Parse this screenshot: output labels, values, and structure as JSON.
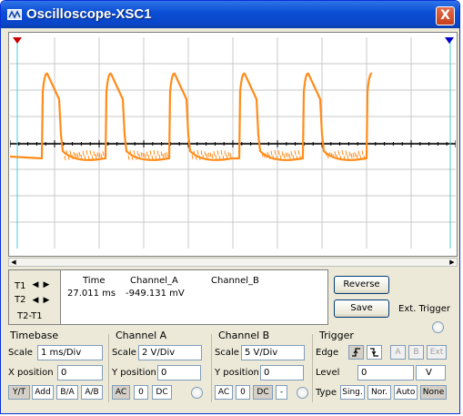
{
  "window": {
    "title": "Oscilloscope-XSC1",
    "close_glyph": "X"
  },
  "colors": {
    "title_bar": "#0a46c8",
    "trace_a": "#ff8c1a",
    "cursor_1": "#cc0000",
    "cursor_2": "#0000cc",
    "cursor_line": "#44cccc",
    "grid": "#c8c8c8",
    "axis": "#000000",
    "window_bg": "#ece9d8"
  },
  "display": {
    "cursor_markers": {
      "t1": "red-triangle",
      "t2": "blue-triangle"
    }
  },
  "readout": {
    "rows": [
      "T1",
      "T2"
    ],
    "t2t1_label": "T2-T1",
    "headers": {
      "time": "Time",
      "channel_a": "Channel_A",
      "channel_b": "Channel_B"
    },
    "values": {
      "time": "27.011 ms",
      "channel_a": "-949.131 mV",
      "channel_b": ""
    }
  },
  "buttons": {
    "reverse": "Reverse",
    "save": "Save",
    "ext_trigger": "Ext. Trigger"
  },
  "timebase": {
    "title": "Timebase",
    "scale_label": "Scale",
    "scale_value": "1 ms/Div",
    "xpos_label": "X position",
    "xpos_value": "0",
    "modes": [
      "Y/T",
      "Add",
      "B/A",
      "A/B"
    ],
    "selected_mode": "Y/T"
  },
  "channel_a": {
    "title": "Channel A",
    "scale_label": "Scale",
    "scale_value": "2  V/Div",
    "ypos_label": "Y position",
    "ypos_value": "0",
    "coupling": [
      "AC",
      "0",
      "DC"
    ],
    "selected_coupling": "AC"
  },
  "channel_b": {
    "title": "Channel B",
    "scale_label": "Scale",
    "scale_value": "5  V/Div",
    "ypos_label": "Y position",
    "ypos_value": "0",
    "coupling": [
      "AC",
      "0",
      "DC",
      "-"
    ],
    "selected_coupling": "DC"
  },
  "trigger": {
    "title": "Trigger",
    "edge_label": "Edge",
    "edge_buttons": [
      "rising-edge-icon",
      "falling-edge-icon"
    ],
    "source_buttons": [
      "A",
      "B",
      "Ext"
    ],
    "level_label": "Level",
    "level_value": "0",
    "level_unit": "V",
    "type_label": "Type",
    "types": [
      "Sing.",
      "Nor.",
      "Auto",
      "None"
    ],
    "selected_type": "None"
  }
}
